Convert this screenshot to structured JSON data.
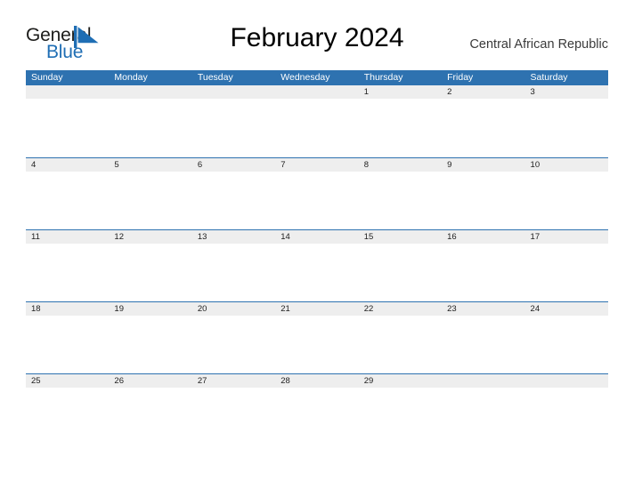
{
  "brand": {
    "name_primary": "General",
    "name_secondary": "Blue",
    "mark": "triangle-flag-icon",
    "primary_color": "#1d1d1b",
    "secondary_color": "#1f6eb4"
  },
  "header": {
    "title": "February 2024",
    "region": "Central African Republic"
  },
  "calendar": {
    "header_bg_color": "#2e72b0",
    "band_bg_color": "#eeeeee",
    "rule_color": "#2e72b0",
    "weekdays": [
      "Sunday",
      "Monday",
      "Tuesday",
      "Wednesday",
      "Thursday",
      "Friday",
      "Saturday"
    ],
    "weeks": [
      [
        "",
        "",
        "",
        "",
        "1",
        "2",
        "3"
      ],
      [
        "4",
        "5",
        "6",
        "7",
        "8",
        "9",
        "10"
      ],
      [
        "11",
        "12",
        "13",
        "14",
        "15",
        "16",
        "17"
      ],
      [
        "18",
        "19",
        "20",
        "21",
        "22",
        "23",
        "24"
      ],
      [
        "25",
        "26",
        "27",
        "28",
        "29",
        "",
        ""
      ]
    ]
  }
}
